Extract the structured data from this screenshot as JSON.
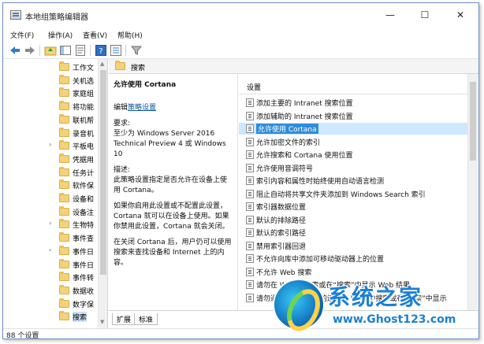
{
  "window": {
    "title": "本地组策略编辑器",
    "controls": {
      "minimize": "—",
      "maximize": "☐",
      "close": "✕"
    }
  },
  "menubar": {
    "items": [
      "文件(F)",
      "操作(A)",
      "查看(V)",
      "帮助(H)"
    ]
  },
  "toolbar": {
    "icons": [
      "back-arrow-icon",
      "forward-arrow-icon",
      "up-folder-icon",
      "show-hide-tree-icon",
      "export-list-icon",
      "help-icon",
      "properties-icon",
      "filter-icon"
    ]
  },
  "tree": {
    "items": [
      {
        "label": "工作文",
        "expandable": false
      },
      {
        "label": "关机选",
        "expandable": false
      },
      {
        "label": "家庭组",
        "expandable": false
      },
      {
        "label": "将功能",
        "expandable": false
      },
      {
        "label": "联机帮",
        "expandable": false
      },
      {
        "label": "录音机",
        "expandable": false
      },
      {
        "label": "平板电",
        "expandable": true
      },
      {
        "label": "凭据用",
        "expandable": false
      },
      {
        "label": "任务计",
        "expandable": false
      },
      {
        "label": "软件保",
        "expandable": false
      },
      {
        "label": "设备和",
        "expandable": false
      },
      {
        "label": "设备注",
        "expandable": false
      },
      {
        "label": "生物特",
        "expandable": true
      },
      {
        "label": "事件查",
        "expandable": false
      },
      {
        "label": "事件日",
        "expandable": true
      },
      {
        "label": "事件日",
        "expandable": false
      },
      {
        "label": "事件转",
        "expandable": false
      },
      {
        "label": "数据收",
        "expandable": false
      },
      {
        "label": "数字保",
        "expandable": false
      },
      {
        "label": "搜索",
        "expandable": false,
        "selected": true
      }
    ]
  },
  "pane": {
    "header": "搜索"
  },
  "description": {
    "title": "允许使用 Cortana",
    "edit_prefix": "编辑",
    "edit_link": "策略设置",
    "requirements_label": "要求:",
    "requirements": "至少为 Windows Server 2016 Technical Preview 4 或 Windows 10",
    "description_label": "描述:",
    "body1": "此策略设置指定是否允许在设备上使用 Cortana。",
    "body2": "如果你启用此设置或不配置此设置，Cortana 就可以在设备上使用。如果你禁用此设置，Cortana 就会关闭。",
    "body3": "在关闭 Cortana 后，用户仍可以使用搜索来查找设备和 Internet 上的内容。"
  },
  "settings": {
    "header": "设置",
    "rows": [
      {
        "label": "添加主要的 Intranet 搜索位置"
      },
      {
        "label": "添加辅助的 Intranet 搜索位置"
      },
      {
        "label": "允许使用 Cortana",
        "selected": true
      },
      {
        "label": "允许加密文件的索引"
      },
      {
        "label": "允许搜索和 Cortana 使用位置"
      },
      {
        "label": "允许使用音调符号"
      },
      {
        "label": "索引内容和属性时始终使用自动语言检测"
      },
      {
        "label": "阻止自动将共享文件夹添加到 Windows Search 索引"
      },
      {
        "label": "索引器数据位置"
      },
      {
        "label": "默认的排除路径"
      },
      {
        "label": "默认的索引路径"
      },
      {
        "label": "禁用索引器回退"
      },
      {
        "label": "不允许向库中添加可移动驱动器上的位置"
      },
      {
        "label": "不允许 Web 搜索"
      },
      {
        "label": "请勿在 Web 中搜索或在“搜索”中显示 Web 结果"
      },
      {
        "label": "请勿通过按流量计费的连接在 Web 中搜索或在“搜索”中显示"
      }
    ]
  },
  "tabs": {
    "items": [
      "扩展",
      "标准"
    ]
  },
  "status": {
    "text": "88 个设置"
  },
  "watermark": {
    "title": "系统之家",
    "url": "www.Ghost123.com"
  }
}
